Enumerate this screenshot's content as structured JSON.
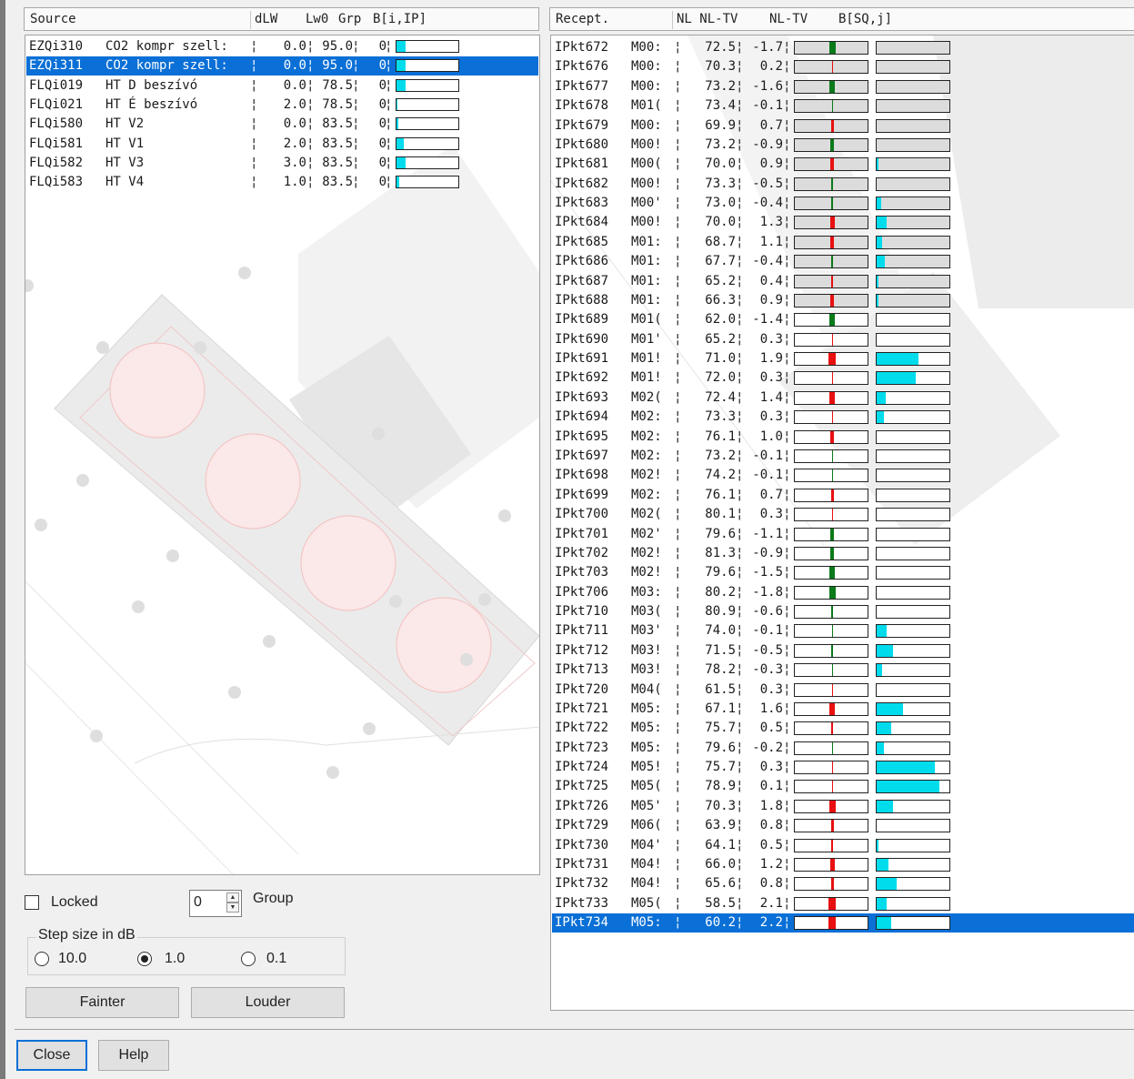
{
  "source_panel": {
    "columns": [
      "Source",
      "dLW",
      "Lw0",
      "Grp",
      "B[i,IP]"
    ],
    "rows": [
      {
        "id": "EZQi310",
        "name": "CO2 kompr szell:",
        "dlw": "0.0",
        "lw0": "95.0",
        "grp": "0",
        "b": 0.14,
        "selected": false
      },
      {
        "id": "EZQi311",
        "name": "CO2 kompr szell:",
        "dlw": "0.0",
        "lw0": "95.0",
        "grp": "0",
        "b": 0.14,
        "selected": true
      },
      {
        "id": "FLQi019",
        "name": "HT D beszívó",
        "dlw": "0.0",
        "lw0": "78.5",
        "grp": "0",
        "b": 0.14,
        "selected": false
      },
      {
        "id": "FLQi021",
        "name": "HT É beszívó",
        "dlw": "2.0",
        "lw0": "78.5",
        "grp": "0",
        "b": 0.02,
        "selected": false
      },
      {
        "id": "FLQi580",
        "name": "HT V2",
        "dlw": "0.0",
        "lw0": "83.5",
        "grp": "0",
        "b": 0.03,
        "selected": false
      },
      {
        "id": "FLQi581",
        "name": "HT V1",
        "dlw": "2.0",
        "lw0": "83.5",
        "grp": "0",
        "b": 0.12,
        "selected": false
      },
      {
        "id": "FLQi582",
        "name": "HT V3",
        "dlw": "3.0",
        "lw0": "83.5",
        "grp": "0",
        "b": 0.14,
        "selected": false
      },
      {
        "id": "FLQi583",
        "name": "HT V4",
        "dlw": "1.0",
        "lw0": "83.5",
        "grp": "0",
        "b": 0.04,
        "selected": false
      }
    ]
  },
  "controls": {
    "locked_label": "Locked",
    "locked_checked": false,
    "group_value": "0",
    "group_label": "Group",
    "step_label": "Step size in dB",
    "step_options": [
      {
        "label": "10.0",
        "selected": false
      },
      {
        "label": "1.0",
        "selected": true
      },
      {
        "label": "0.1",
        "selected": false
      }
    ],
    "fainter_label": "Fainter",
    "louder_label": "Louder",
    "close_label": "Close",
    "help_label": "Help"
  },
  "receptor_panel": {
    "columns": [
      "Recept.",
      "NL NL-TV",
      "NL-TV",
      "B[SQ,j]"
    ],
    "rows": [
      {
        "id": "IPkt672",
        "m": "M00:",
        "nl": "72.5",
        "nltv": "-1.7",
        "b": 0.0
      },
      {
        "id": "IPkt676",
        "m": "M00:",
        "nl": "70.3",
        "nltv": "0.2",
        "b": 0.0
      },
      {
        "id": "IPkt677",
        "m": "M00:",
        "nl": "73.2",
        "nltv": "-1.6",
        "b": 0.0
      },
      {
        "id": "IPkt678",
        "m": "M01(",
        "nl": "73.4",
        "nltv": "-0.1",
        "b": 0.0
      },
      {
        "id": "IPkt679",
        "m": "M00:",
        "nl": "69.9",
        "nltv": "0.7",
        "b": 0.0
      },
      {
        "id": "IPkt680",
        "m": "M00!",
        "nl": "73.2",
        "nltv": "-0.9",
        "b": 0.0
      },
      {
        "id": "IPkt681",
        "m": "M00(",
        "nl": "70.0",
        "nltv": "0.9",
        "b": 0.02
      },
      {
        "id": "IPkt682",
        "m": "M00!",
        "nl": "73.3",
        "nltv": "-0.5",
        "b": 0.0
      },
      {
        "id": "IPkt683",
        "m": "M00'",
        "nl": "73.0",
        "nltv": "-0.4",
        "b": 0.06
      },
      {
        "id": "IPkt684",
        "m": "M00!",
        "nl": "70.0",
        "nltv": "1.3",
        "b": 0.14
      },
      {
        "id": "IPkt685",
        "m": "M01:",
        "nl": "68.7",
        "nltv": "1.1",
        "b": 0.08
      },
      {
        "id": "IPkt686",
        "m": "M01:",
        "nl": "67.7",
        "nltv": "-0.4",
        "b": 0.11
      },
      {
        "id": "IPkt687",
        "m": "M01:",
        "nl": "65.2",
        "nltv": "0.4",
        "b": 0.03
      },
      {
        "id": "IPkt688",
        "m": "M01:",
        "nl": "66.3",
        "nltv": "0.9",
        "b": 0.02
      },
      {
        "id": "IPkt689",
        "m": "M01(",
        "nl": "62.0",
        "nltv": "-1.4",
        "b": 0.0
      },
      {
        "id": "IPkt690",
        "m": "M01'",
        "nl": "65.2",
        "nltv": "0.3",
        "b": 0.0
      },
      {
        "id": "IPkt691",
        "m": "M01!",
        "nl": "71.0",
        "nltv": "1.9",
        "b": 0.58
      },
      {
        "id": "IPkt692",
        "m": "M01!",
        "nl": "72.0",
        "nltv": "0.3",
        "b": 0.54
      },
      {
        "id": "IPkt693",
        "m": "M02(",
        "nl": "72.4",
        "nltv": "1.4",
        "b": 0.12
      },
      {
        "id": "IPkt694",
        "m": "M02:",
        "nl": "73.3",
        "nltv": "0.3",
        "b": 0.1
      },
      {
        "id": "IPkt695",
        "m": "M02:",
        "nl": "76.1",
        "nltv": "1.0",
        "b": 0.0
      },
      {
        "id": "IPkt697",
        "m": "M02:",
        "nl": "73.2",
        "nltv": "-0.1",
        "b": 0.0
      },
      {
        "id": "IPkt698",
        "m": "M02!",
        "nl": "74.2",
        "nltv": "-0.1",
        "b": 0.0
      },
      {
        "id": "IPkt699",
        "m": "M02:",
        "nl": "76.1",
        "nltv": "0.7",
        "b": 0.0
      },
      {
        "id": "IPkt700",
        "m": "M02(",
        "nl": "80.1",
        "nltv": "0.3",
        "b": 0.0
      },
      {
        "id": "IPkt701",
        "m": "M02'",
        "nl": "79.6",
        "nltv": "-1.1",
        "b": 0.0
      },
      {
        "id": "IPkt702",
        "m": "M02!",
        "nl": "81.3",
        "nltv": "-0.9",
        "b": 0.0
      },
      {
        "id": "IPkt703",
        "m": "M02!",
        "nl": "79.6",
        "nltv": "-1.5",
        "b": 0.0
      },
      {
        "id": "IPkt706",
        "m": "M03:",
        "nl": "80.2",
        "nltv": "-1.8",
        "b": 0.0
      },
      {
        "id": "IPkt710",
        "m": "M03(",
        "nl": "80.9",
        "nltv": "-0.6",
        "b": 0.0
      },
      {
        "id": "IPkt711",
        "m": "M03'",
        "nl": "74.0",
        "nltv": "-0.1",
        "b": 0.14
      },
      {
        "id": "IPkt712",
        "m": "M03!",
        "nl": "71.5",
        "nltv": "-0.5",
        "b": 0.23
      },
      {
        "id": "IPkt713",
        "m": "M03!",
        "nl": "78.2",
        "nltv": "-0.3",
        "b": 0.07
      },
      {
        "id": "IPkt720",
        "m": "M04(",
        "nl": "61.5",
        "nltv": "0.3",
        "b": 0.0
      },
      {
        "id": "IPkt721",
        "m": "M05:",
        "nl": "67.1",
        "nltv": "1.6",
        "b": 0.36
      },
      {
        "id": "IPkt722",
        "m": "M05:",
        "nl": "75.7",
        "nltv": "0.5",
        "b": 0.2
      },
      {
        "id": "IPkt723",
        "m": "M05:",
        "nl": "79.6",
        "nltv": "-0.2",
        "b": 0.1
      },
      {
        "id": "IPkt724",
        "m": "M05!",
        "nl": "75.7",
        "nltv": "0.3",
        "b": 0.8
      },
      {
        "id": "IPkt725",
        "m": "M05(",
        "nl": "78.9",
        "nltv": "0.1",
        "b": 0.86
      },
      {
        "id": "IPkt726",
        "m": "M05'",
        "nl": "70.3",
        "nltv": "1.8",
        "b": 0.23
      },
      {
        "id": "IPkt729",
        "m": "M06(",
        "nl": "63.9",
        "nltv": "0.8",
        "b": 0.0
      },
      {
        "id": "IPkt730",
        "m": "M04'",
        "nl": "64.1",
        "nltv": "0.5",
        "b": 0.03
      },
      {
        "id": "IPkt731",
        "m": "M04!",
        "nl": "66.0",
        "nltv": "1.2",
        "b": 0.16
      },
      {
        "id": "IPkt732",
        "m": "M04!",
        "nl": "65.6",
        "nltv": "0.8",
        "b": 0.28
      },
      {
        "id": "IPkt733",
        "m": "M05(",
        "nl": "58.5",
        "nltv": "2.1",
        "b": 0.14
      },
      {
        "id": "IPkt734",
        "m": "M05:",
        "nl": "60.2",
        "nltv": "2.2",
        "b": 0.2,
        "selected": true
      }
    ]
  },
  "colors": {
    "selection": "#0a6fd6",
    "positive_marker": "#e81010",
    "negative_marker": "#0b7a1a",
    "bar_fill": "#00dcec"
  }
}
